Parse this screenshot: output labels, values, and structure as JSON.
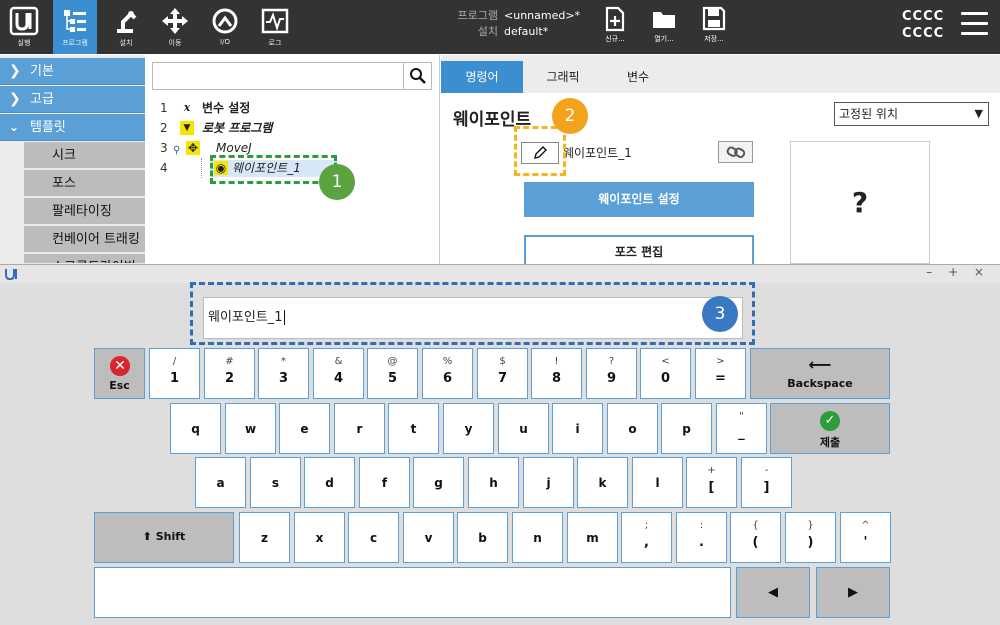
{
  "topbar": {
    "nav": [
      {
        "id": "logo",
        "label": "실행"
      },
      {
        "id": "program",
        "label": "프로그램"
      },
      {
        "id": "install",
        "label": "설치"
      },
      {
        "id": "move",
        "label": "이동"
      },
      {
        "id": "io",
        "label": "I/O"
      },
      {
        "id": "log",
        "label": "로그"
      }
    ],
    "program_key": "프로그램",
    "program_val": "<unnamed>*",
    "install_key": "설치",
    "install_val": "default*",
    "new_label": "신규...",
    "open_label": "열기...",
    "save_label": "저장...",
    "user_line1": "CCCC",
    "user_line2": "CCCC"
  },
  "sidebar": {
    "categories": [
      "기본",
      "고급",
      "템플릿"
    ],
    "items": [
      "시크",
      "포스",
      "팔레타이징",
      "컨베이어 트래킹",
      "스크류드라이빙"
    ]
  },
  "tree": {
    "search_value": "",
    "rows": [
      {
        "num": "1",
        "icon": "x",
        "text": "변수 설정",
        "style": "bold"
      },
      {
        "num": "2",
        "icon": "▼",
        "text": "로봇 프로그램",
        "style": "bold-italic"
      },
      {
        "num": "3",
        "icon": "✥",
        "text": "MoveJ",
        "style": "italic"
      },
      {
        "num": "4",
        "icon": "◉",
        "text": "웨이포인트_1",
        "style": "italic"
      }
    ]
  },
  "panel": {
    "tabs": [
      "명령어",
      "그래픽",
      "변수"
    ],
    "title": "웨이포인트",
    "dropdown_value": "고정된 위치",
    "wp_name": "웨이포인트_1",
    "set_button": "웨이포인트 설정",
    "pose_button": "포즈 편집",
    "question": "?"
  },
  "callouts": [
    "1",
    "2",
    "3"
  ],
  "keyboard": {
    "window_controls": "– + ×",
    "input_value": "웨이포인트_1",
    "esc": "Esc",
    "backspace": "Backspace",
    "submit": "제출",
    "shift": "Shift",
    "row1": [
      {
        "t": "/",
        "m": "1"
      },
      {
        "t": "#",
        "m": "2"
      },
      {
        "t": "*",
        "m": "3"
      },
      {
        "t": "&",
        "m": "4"
      },
      {
        "t": "@",
        "m": "5"
      },
      {
        "t": "%",
        "m": "6"
      },
      {
        "t": "$",
        "m": "7"
      },
      {
        "t": "!",
        "m": "8"
      },
      {
        "t": "?",
        "m": "9"
      },
      {
        "t": "<",
        "m": "0"
      },
      {
        "t": ">",
        "m": "="
      }
    ],
    "row2": [
      {
        "t": "",
        "m": "q"
      },
      {
        "t": "",
        "m": "w"
      },
      {
        "t": "",
        "m": "e"
      },
      {
        "t": "",
        "m": "r"
      },
      {
        "t": "",
        "m": "t"
      },
      {
        "t": "",
        "m": "y"
      },
      {
        "t": "",
        "m": "u"
      },
      {
        "t": "",
        "m": "i"
      },
      {
        "t": "",
        "m": "o"
      },
      {
        "t": "",
        "m": "p"
      },
      {
        "t": "\"",
        "m": "_"
      }
    ],
    "row3": [
      {
        "t": "",
        "m": "a"
      },
      {
        "t": "",
        "m": "s"
      },
      {
        "t": "",
        "m": "d"
      },
      {
        "t": "",
        "m": "f"
      },
      {
        "t": "",
        "m": "g"
      },
      {
        "t": "",
        "m": "h"
      },
      {
        "t": "",
        "m": "j"
      },
      {
        "t": "",
        "m": "k"
      },
      {
        "t": "",
        "m": "l"
      },
      {
        "t": "+",
        "m": "["
      },
      {
        "t": "-",
        "m": "]"
      }
    ],
    "row4": [
      {
        "t": "",
        "m": "z"
      },
      {
        "t": "",
        "m": "x"
      },
      {
        "t": "",
        "m": "c"
      },
      {
        "t": "",
        "m": "v"
      },
      {
        "t": "",
        "m": "b"
      },
      {
        "t": "",
        "m": "n"
      },
      {
        "t": "",
        "m": "m"
      },
      {
        "t": ";",
        "m": ","
      },
      {
        "t": ":",
        "m": "."
      },
      {
        "t": "{",
        "m": "("
      },
      {
        "t": "}",
        "m": ")"
      },
      {
        "t": "^",
        "m": "'"
      }
    ]
  },
  "colors": {
    "accent": "#5aa0d7",
    "active_nav": "#3b8fd0",
    "topbar": "#333333",
    "callout_green": "#5aa33e",
    "callout_orange": "#f2a21b",
    "callout_blue": "#3a78c2",
    "dash_green": "#2e9b3c",
    "dash_orange": "#f2b51b",
    "dash_blue": "#2f6db5"
  }
}
